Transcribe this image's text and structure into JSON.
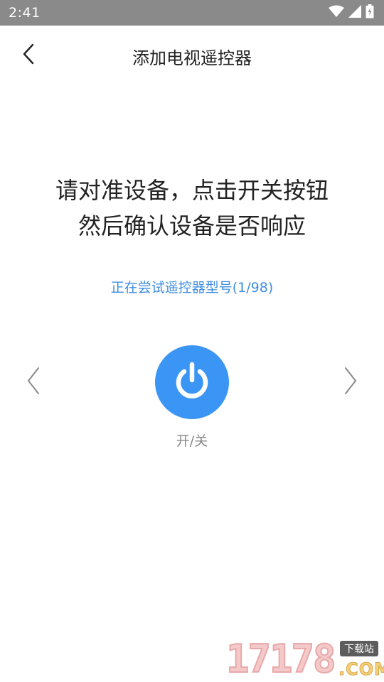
{
  "status_bar": {
    "time": "2:41",
    "icons": [
      "wifi-icon",
      "signal-icon",
      "battery-icon"
    ],
    "background_color": "#8a8a8a"
  },
  "header": {
    "title": "添加电视遥控器",
    "back_icon": "chevron-left-icon"
  },
  "instructions": {
    "line1": "请对准设备，点击开关按钮",
    "line2": "然后确认设备是否响应"
  },
  "model_status": {
    "text": "正在尝试遥控器型号(1/98)",
    "color": "#3f8ee0"
  },
  "power_button": {
    "icon": "power-icon",
    "label": "开/关",
    "color": "#3a95f5"
  },
  "navigation": {
    "prev_icon": "chevron-left-icon",
    "next_icon": "chevron-right-icon"
  },
  "watermark": {
    "digits": "17178",
    "tag": "下载站",
    "domain": ".COM"
  }
}
